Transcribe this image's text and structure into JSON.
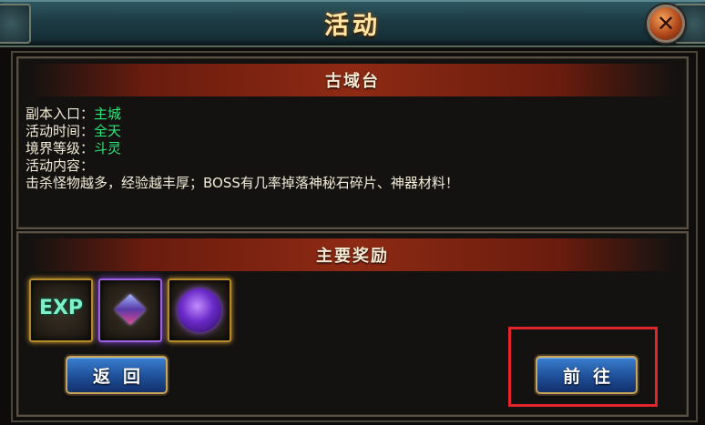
{
  "window": {
    "title": "活动"
  },
  "info_panel": {
    "header": "古域台",
    "entry_label": "副本入口：",
    "entry_value": "主城",
    "time_label": "活动时间：",
    "time_value": "全天",
    "level_label": "境界等级：",
    "level_value": "斗灵",
    "content_label": "活动内容：",
    "content_text": "击杀怪物越多，经验越丰厚；BOSS有几率掉落神秘石碎片、神器材料！"
  },
  "reward_panel": {
    "header": "主要奖励",
    "items": [
      {
        "name": "exp-item",
        "label": "EXP",
        "frame_color": "#b58a2a"
      },
      {
        "name": "gem-item",
        "icon": "gem-icon",
        "frame_color": "#9b63e0"
      },
      {
        "name": "orb-item",
        "icon": "purple-orb-icon",
        "frame_color": "#b58a2a"
      }
    ]
  },
  "buttons": {
    "back": "返回",
    "go": "前往"
  },
  "colors": {
    "highlight_box": "#e0262a",
    "value_green": "#2ee57a",
    "button_blue": "#1f4f98"
  }
}
